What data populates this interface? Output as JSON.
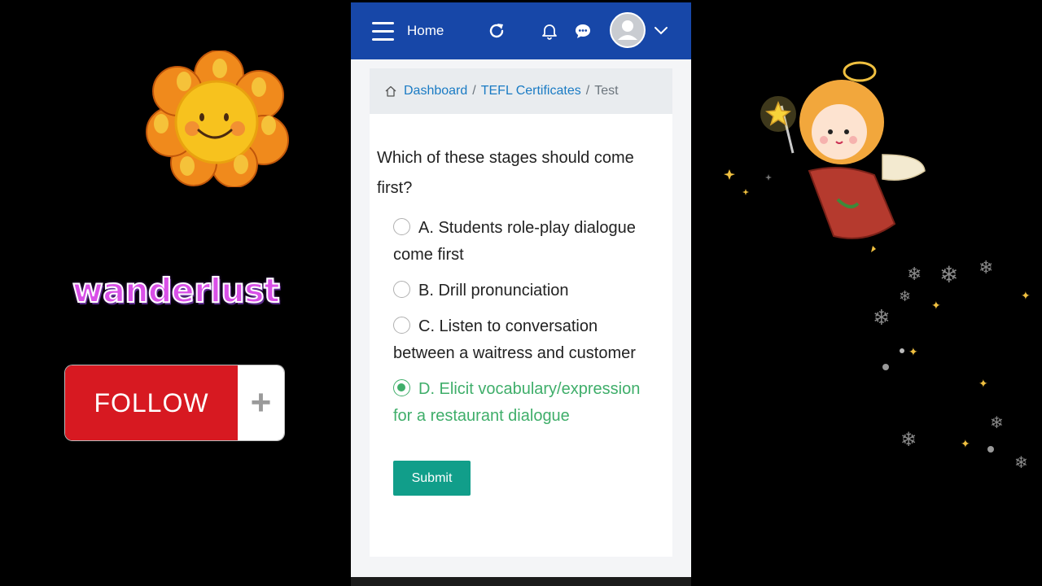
{
  "overlay": {
    "wanderlust_text": "wanderlust",
    "follow_label": "FOLLOW",
    "follow_plus": "+"
  },
  "header": {
    "home_label": "Home",
    "icons": [
      "menu-icon",
      "refresh-icon",
      "bell-icon",
      "chat-icon",
      "avatar",
      "chevron-down-icon"
    ]
  },
  "breadcrumb": {
    "items": [
      {
        "label": "Dashboard",
        "link": true
      },
      {
        "label": "TEFL Certificates",
        "link": true
      },
      {
        "label": "Test",
        "link": false
      }
    ],
    "separator": "/"
  },
  "quiz": {
    "question": "Which of these stages should come first?",
    "options": [
      {
        "label": "A. Students role-play dialogue come first",
        "selected": false
      },
      {
        "label": "B. Drill pronunciation",
        "selected": false
      },
      {
        "label": "C. Listen to conversation between a waitress and customer",
        "selected": false
      },
      {
        "label": "D. Elicit vocabulary/expression for a restaurant dialogue",
        "selected": true
      }
    ],
    "submit_label": "Submit"
  },
  "colors": {
    "header_bg": "#1747a8",
    "link": "#1a7bc4",
    "selected": "#3fae6a",
    "submit_bg": "#119e8a",
    "follow_red": "#d71921"
  }
}
